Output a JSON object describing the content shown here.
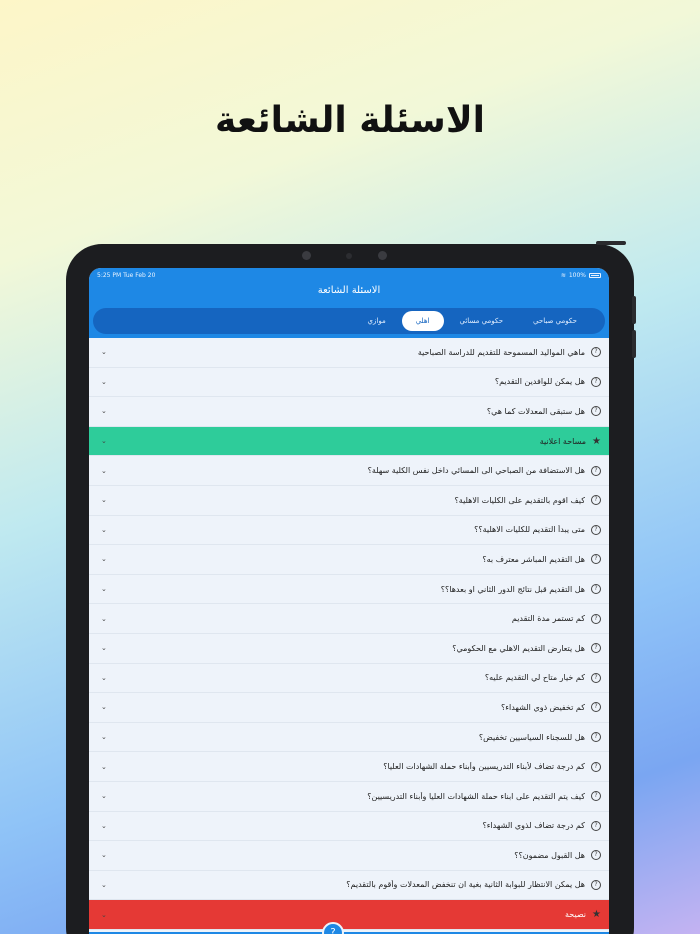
{
  "hero": {
    "title": "الاسئلة الشائعة"
  },
  "status": {
    "time": "5:25 PM  Tue Feb 20",
    "battery": "100%"
  },
  "appbar": {
    "title": "الاسئلة الشائعة"
  },
  "tabs": [
    {
      "label": "حكومي صباحي",
      "active": false
    },
    {
      "label": "حكومي مسائي",
      "active": false
    },
    {
      "label": "اهلي",
      "active": true
    },
    {
      "label": "موازي",
      "active": false
    }
  ],
  "questions_top": [
    "ماهي المواليد المسموحة للتقديم للدراسة الصباحية",
    "هل يمكن للوافدين التقديم؟",
    "هل ستبقى المعدلات كما هي؟"
  ],
  "ad_row": {
    "label": "مساحة اعلانية",
    "color": "#2ecc9a"
  },
  "questions_bottom": [
    "هل الاستضافة من الصباحي الى المسائي داخل نفس الكلية سهلة؟",
    "كيف اقوم بالتقديم على الكليات الاهلية؟",
    "متى يبدأ التقديم للكليات الاهلية؟؟",
    "هل التقديم المباشر معترف به؟",
    "هل التقديم قبل نتائج الدور الثاني او بعدها؟؟",
    "كم تستمر مدة التقديم",
    "هل يتعارض التقديم الاهلي مع الحكومي؟",
    "كم خيار متاح لي التقديم عليه؟",
    "كم تخفيض ذوي الشهداء؟",
    "هل للسجناء السياسيين تخفيض؟",
    "كم درجة تضاف لأبناء التدريسيين وأبناء حملة الشهادات العليا؟",
    "كيف يتم التقديم على ابناء حملة الشهادات العليا وأبناء التدريسيين؟",
    "كم درجة تضاف لذوي الشهداء؟",
    "هل القبول مضمون؟؟",
    "هل يمكن الانتظار للبوابة الثانية بغية ان تنخفض المعدلات وأقوم بالتقديم؟"
  ],
  "tip_row": {
    "label": "نصيحة",
    "color": "#e53935"
  },
  "icons": {
    "question": "question-circle-icon",
    "chevron": "chevron-down-icon",
    "star": "star-icon",
    "fab": "question-fab-icon"
  },
  "colors": {
    "primary": "#1e88e5",
    "primary_dark": "#1565c0"
  }
}
